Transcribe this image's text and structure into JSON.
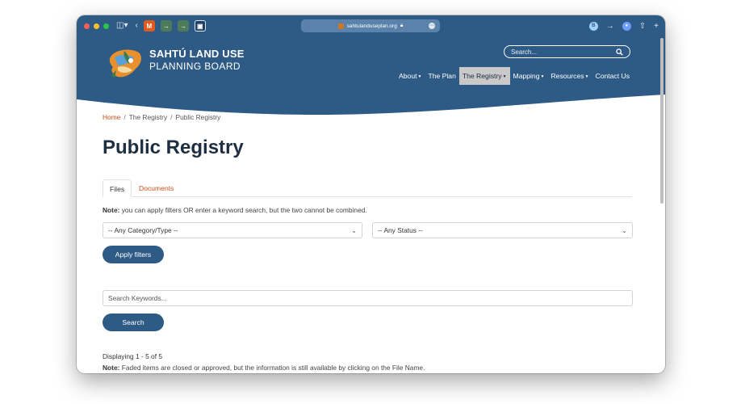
{
  "browser": {
    "url": "sahtulanduseplan.org",
    "favicons": [
      "M",
      "→",
      "→",
      "▣"
    ]
  },
  "site": {
    "brand_title": "SAHTÚ LAND USE",
    "brand_subtitle": "PLANNING BOARD",
    "search_placeholder": "Search...",
    "nav": [
      {
        "label": "About",
        "has_caret": true
      },
      {
        "label": "The Plan",
        "has_caret": false
      },
      {
        "label": "The Registry",
        "has_caret": true,
        "active": true
      },
      {
        "label": "Mapping",
        "has_caret": true
      },
      {
        "label": "Resources",
        "has_caret": true
      },
      {
        "label": "Contact Us",
        "has_caret": false
      }
    ],
    "colors": {
      "brand": "#2e5a86",
      "link": "#c8531b",
      "active_nav": "#c9c9c9"
    }
  },
  "breadcrumb": {
    "home": "Home",
    "registry": "The Registry",
    "current": "Public Registry",
    "separator": "/"
  },
  "page": {
    "title": "Public Registry",
    "tabs": [
      {
        "label": "Files",
        "active": true
      },
      {
        "label": "Documents",
        "active": false
      }
    ],
    "note_label": "Note:",
    "filter_note": "you can apply filters OR enter a keyword search, but the two cannot be combined.",
    "category_select": "-- Any Category/Type --",
    "status_select": "-- Any Status --",
    "apply_button": "Apply filters",
    "keyword_placeholder": "Search Keywords...",
    "search_button": "Search",
    "displaying": "Displaying 1 - 5 of 5",
    "faded_note": "Faded items are closed or approved, but the information is still available by clicking on the File Name."
  }
}
